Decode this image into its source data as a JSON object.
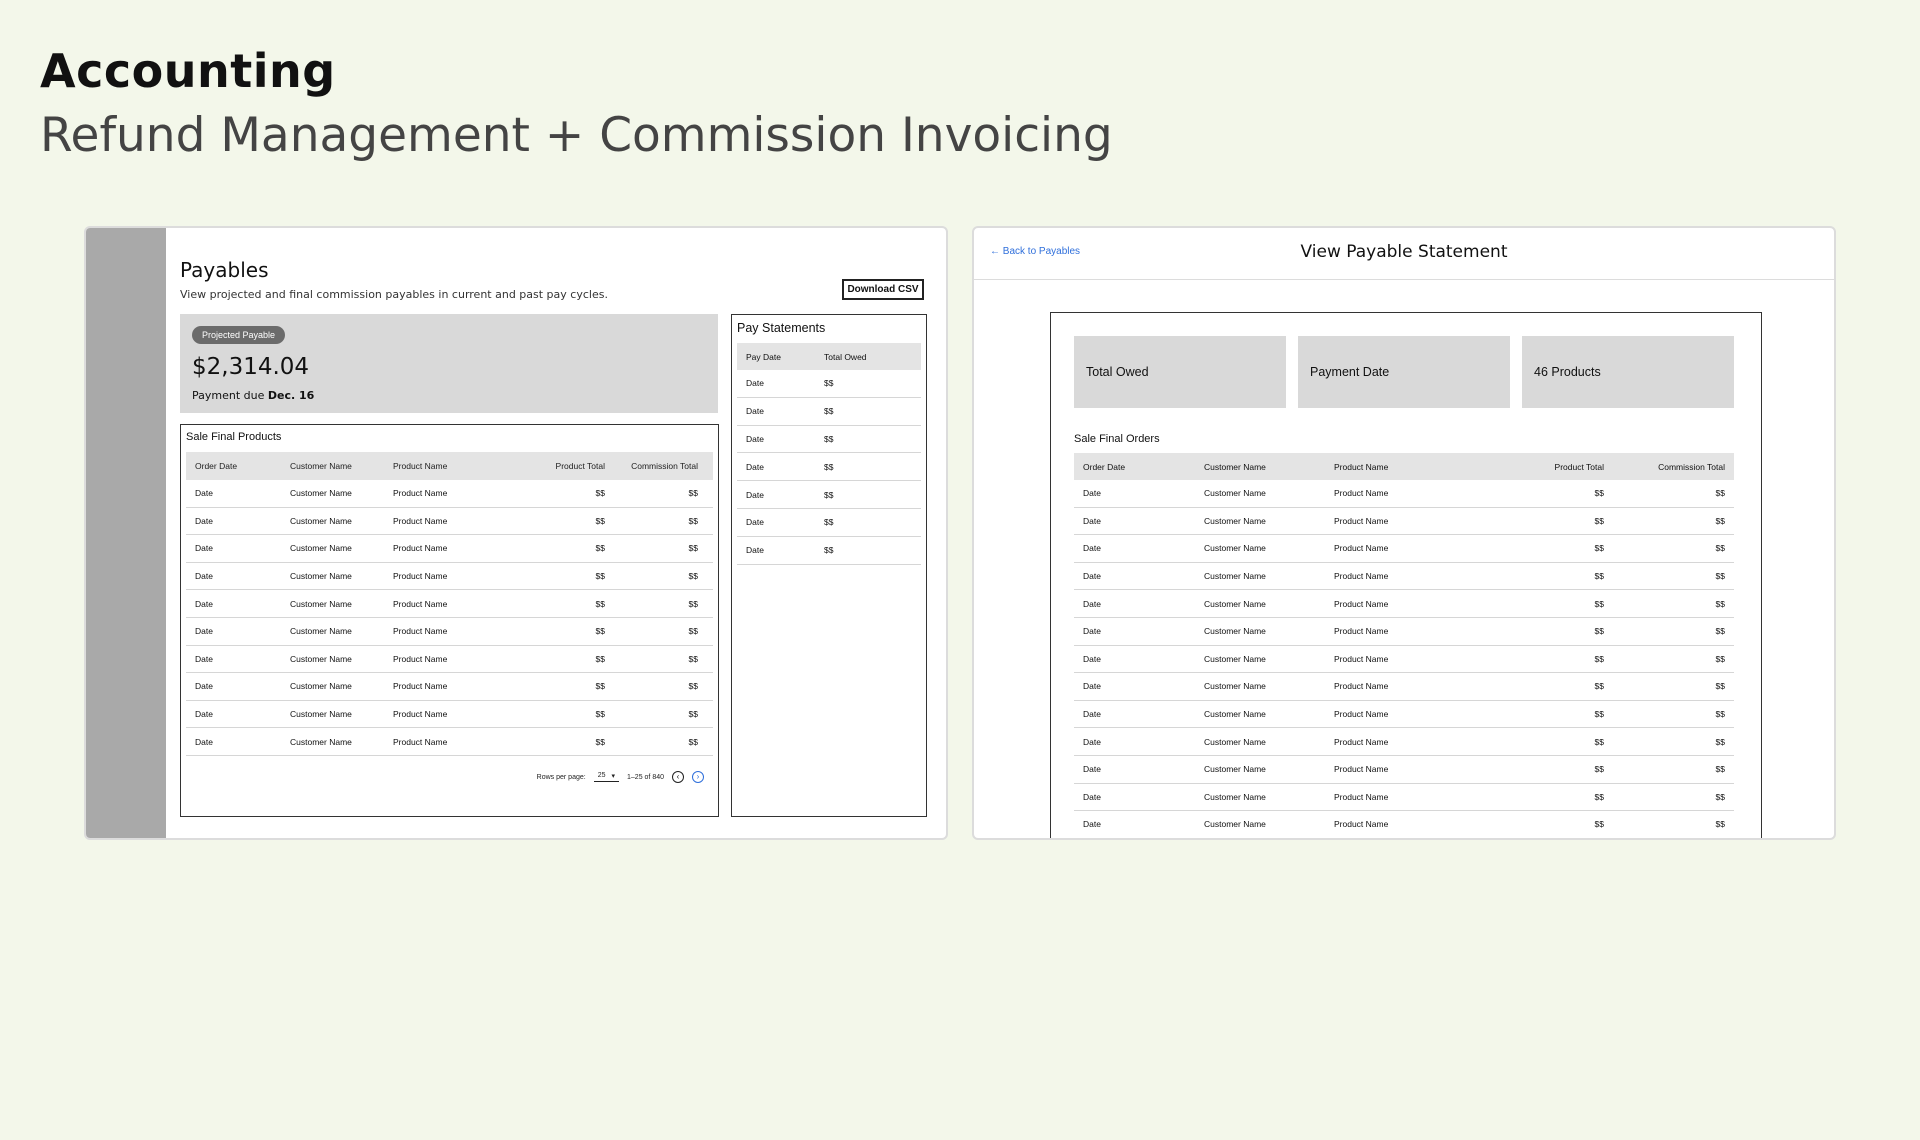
{
  "hero": {
    "title": "Accounting",
    "subtitle": "Refund Management + Commission Invoicing"
  },
  "payables": {
    "title": "Payables",
    "description": "View projected and final commission payables in current and past pay cycles.",
    "download_label": "Download CSV",
    "projected": {
      "badge": "Projected Payable",
      "amount": "$2,314.04",
      "due_prefix": "Payment due",
      "due_date": "Dec. 16"
    },
    "sale_final": {
      "title": "Sale Final Products",
      "columns": [
        "Order Date",
        "Customer Name",
        "Product Name",
        "Product Total",
        "Commission Total"
      ],
      "rows": [
        [
          "Date",
          "Customer Name",
          "Product Name",
          "$$",
          "$$"
        ],
        [
          "Date",
          "Customer Name",
          "Product Name",
          "$$",
          "$$"
        ],
        [
          "Date",
          "Customer Name",
          "Product Name",
          "$$",
          "$$"
        ],
        [
          "Date",
          "Customer Name",
          "Product Name",
          "$$",
          "$$"
        ],
        [
          "Date",
          "Customer Name",
          "Product Name",
          "$$",
          "$$"
        ],
        [
          "Date",
          "Customer Name",
          "Product Name",
          "$$",
          "$$"
        ],
        [
          "Date",
          "Customer Name",
          "Product Name",
          "$$",
          "$$"
        ],
        [
          "Date",
          "Customer Name",
          "Product Name",
          "$$",
          "$$"
        ],
        [
          "Date",
          "Customer Name",
          "Product Name",
          "$$",
          "$$"
        ],
        [
          "Date",
          "Customer Name",
          "Product Name",
          "$$",
          "$$"
        ]
      ],
      "pagination": {
        "rows_label": "Rows per page:",
        "rows_value": "25",
        "range": "1–25 of 840"
      }
    },
    "statements": {
      "title": "Pay Statements",
      "columns": [
        "Pay Date",
        "Total Owed"
      ],
      "rows": [
        [
          "Date",
          "$$"
        ],
        [
          "Date",
          "$$"
        ],
        [
          "Date",
          "$$"
        ],
        [
          "Date",
          "$$"
        ],
        [
          "Date",
          "$$"
        ],
        [
          "Date",
          "$$"
        ],
        [
          "Date",
          "$$"
        ]
      ]
    }
  },
  "statement_view": {
    "back_label": "Back to Payables",
    "title": "View Payable Statement",
    "stats": [
      "Total Owed",
      "Payment Date",
      "46 Products"
    ],
    "orders": {
      "title": "Sale Final Orders",
      "columns": [
        "Order Date",
        "Customer Name",
        "Product Name",
        "Product Total",
        "Commission Total"
      ],
      "rows": [
        [
          "Date",
          "Customer Name",
          "Product Name",
          "$$",
          "$$"
        ],
        [
          "Date",
          "Customer Name",
          "Product Name",
          "$$",
          "$$"
        ],
        [
          "Date",
          "Customer Name",
          "Product Name",
          "$$",
          "$$"
        ],
        [
          "Date",
          "Customer Name",
          "Product Name",
          "$$",
          "$$"
        ],
        [
          "Date",
          "Customer Name",
          "Product Name",
          "$$",
          "$$"
        ],
        [
          "Date",
          "Customer Name",
          "Product Name",
          "$$",
          "$$"
        ],
        [
          "Date",
          "Customer Name",
          "Product Name",
          "$$",
          "$$"
        ],
        [
          "Date",
          "Customer Name",
          "Product Name",
          "$$",
          "$$"
        ],
        [
          "Date",
          "Customer Name",
          "Product Name",
          "$$",
          "$$"
        ],
        [
          "Date",
          "Customer Name",
          "Product Name",
          "$$",
          "$$"
        ],
        [
          "Date",
          "Customer Name",
          "Product Name",
          "$$",
          "$$"
        ],
        [
          "Date",
          "Customer Name",
          "Product Name",
          "$$",
          "$$"
        ],
        [
          "Date",
          "Customer Name",
          "Product Name",
          "$$",
          "$$"
        ]
      ]
    }
  },
  "colors": {
    "background": "#f3f7ea",
    "link": "#2f6fdb",
    "sidebar": "#a9a9a9",
    "card": "#d9d9d9"
  }
}
